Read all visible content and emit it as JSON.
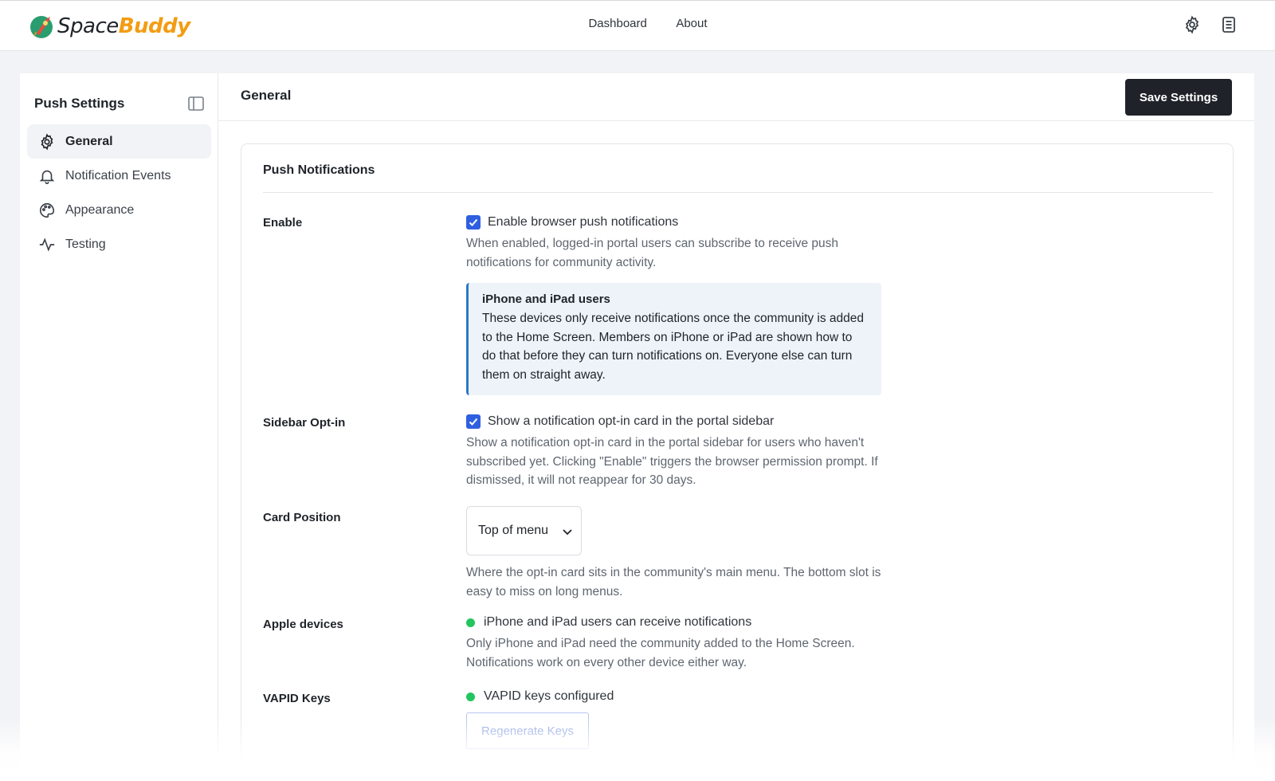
{
  "app": {
    "brand_part1": "Space",
    "brand_part2": "Buddy",
    "brand_colors": {
      "primary": "#f39c12",
      "dark": "#1f2329"
    }
  },
  "topnav": {
    "items": [
      "Dashboard",
      "About"
    ],
    "icons": [
      "gear-icon",
      "document-icon"
    ]
  },
  "sidebar": {
    "title": "Push Settings",
    "items": [
      {
        "label": "General",
        "icon": "gear-icon",
        "active": true
      },
      {
        "label": "Notification Events",
        "icon": "bell-icon",
        "active": false
      },
      {
        "label": "Appearance",
        "icon": "palette-icon",
        "active": false
      },
      {
        "label": "Testing",
        "icon": "activity-icon",
        "active": false
      }
    ]
  },
  "main": {
    "title": "General",
    "save_label": "Save Settings"
  },
  "card": {
    "title": "Push Notifications",
    "enable": {
      "label": "Enable",
      "checkbox_label": "Enable browser push notifications",
      "checked": true,
      "help": "When enabled, logged-in portal users can subscribe to receive push notifications for community activity.",
      "notice_title": "iPhone and iPad users",
      "notice_body": "These devices only receive notifications once the community is added to the Home Screen. Members on iPhone or iPad are shown how to do that before they can turn notifications on. Everyone else can turn them on straight away."
    },
    "sidebar_optin": {
      "label": "Sidebar Opt-in",
      "checkbox_label": "Show a notification opt-in card in the portal sidebar",
      "checked": true,
      "help": "Show a notification opt-in card in the portal sidebar for users who haven't subscribed yet. Clicking \"Enable\" triggers the browser permission prompt. If dismissed, it will not reappear for 30 days."
    },
    "card_position": {
      "label": "Card Position",
      "selected": "Top of menu",
      "help": "Where the opt-in card sits in the community's main menu. The bottom slot is easy to miss on long menus."
    },
    "apple_devices": {
      "label": "Apple devices",
      "status": "iPhone and iPad users can receive notifications",
      "status_color": "#22c55e",
      "help": "Only iPhone and iPad need the community added to the Home Screen. Notifications work on every other device either way."
    },
    "vapid": {
      "label": "VAPID Keys",
      "status": "VAPID keys configured",
      "status_color": "#22c55e",
      "button_label": "Regenerate Keys"
    }
  }
}
